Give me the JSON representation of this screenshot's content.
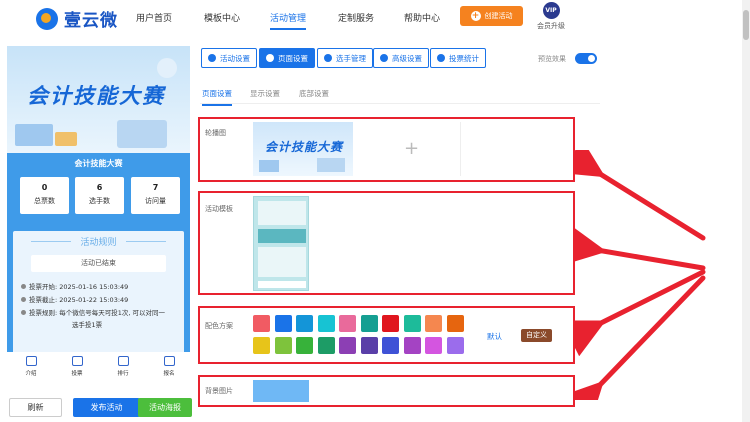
{
  "brand": {
    "logo_text": "壹云微"
  },
  "nav": {
    "items": [
      {
        "label": "用户首页",
        "active": false
      },
      {
        "label": "模板中心",
        "active": false
      },
      {
        "label": "活动管理",
        "active": true
      },
      {
        "label": "定制服务",
        "active": false
      },
      {
        "label": "帮助中心",
        "active": false
      }
    ],
    "create_button": "创建活动",
    "vip_badge": "VIP",
    "vip_label": "会员升级"
  },
  "preview": {
    "banner_title": "会计技能大赛",
    "panel_title": "会计技能大赛",
    "stats": [
      {
        "value": "0",
        "label": "总票数"
      },
      {
        "value": "6",
        "label": "选手数"
      },
      {
        "value": "7",
        "label": "访问量"
      }
    ],
    "rules_title": "活动规则",
    "status": "活动已结束",
    "rules": [
      "投票开始: 2025-01-16 15:03:49",
      "投票截止: 2025-01-22 15:03:49",
      "投票规则: 每个微信号每天可投1次, 可以对同一",
      "选手投1票"
    ],
    "tabs": [
      "介绍",
      "投票",
      "排行",
      "报名"
    ]
  },
  "actions": {
    "refresh": "刷新",
    "publish": "发布活动",
    "poster": "活动海报"
  },
  "toolbar": {
    "buttons": [
      {
        "label": "活动设置",
        "active": false
      },
      {
        "label": "页面设置",
        "active": true
      },
      {
        "label": "选手管理",
        "active": false
      },
      {
        "label": "高级设置",
        "active": false
      },
      {
        "label": "投票统计",
        "active": false
      }
    ],
    "preview_label": "预览效果"
  },
  "subtabs": [
    {
      "label": "页面设置",
      "active": true
    },
    {
      "label": "显示设置",
      "active": false
    },
    {
      "label": "底部设置",
      "active": false
    }
  ],
  "sections": {
    "carousel_label": "轮播图",
    "carousel_image_title": "会计技能大赛",
    "add_icon": "+",
    "template_label": "活动模板",
    "color_label": "配色方案",
    "default_label": "默认",
    "custom_label": "自定义",
    "background_label": "背景图片"
  },
  "colors": {
    "accent": "#1a73e8",
    "highlight_border": "#e8222f",
    "swatches_row1": [
      "#f15b63",
      "#1a73e8",
      "#1495d8",
      "#17c3d3",
      "#e96a9b",
      "#159f92",
      "#e0161e",
      "#1dbb9a",
      "#f5874f",
      "#e6650f"
    ],
    "swatches_row2": [
      "#e7c41a",
      "#7ec33c",
      "#37b23a",
      "#1d9c66",
      "#8c3fb4",
      "#5a3fa8",
      "#3f52d6",
      "#a443c3",
      "#d455e0",
      "#9b6cec"
    ]
  }
}
